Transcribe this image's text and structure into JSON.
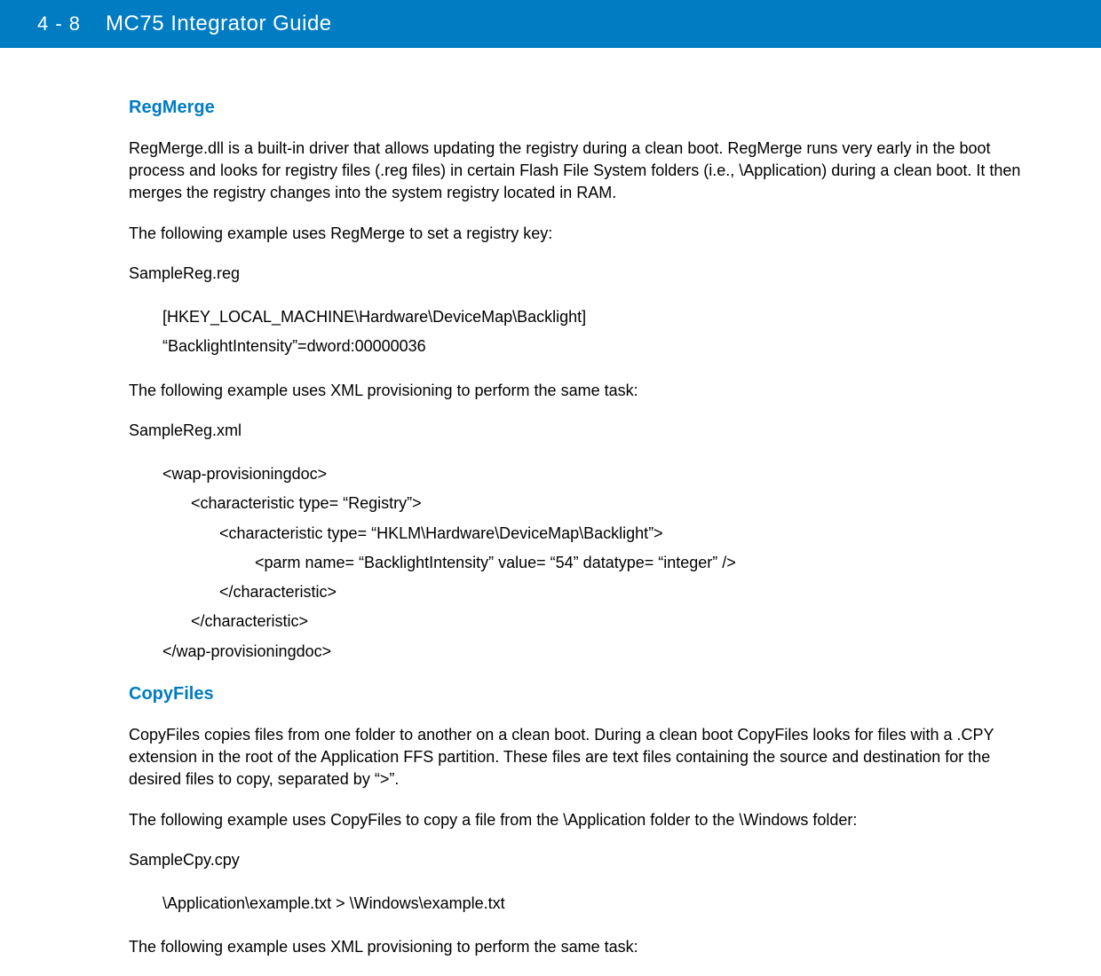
{
  "header": {
    "page_number": "4 - 8",
    "doc_title": "MC75 Integrator Guide"
  },
  "sections": {
    "regmerge": {
      "heading": "RegMerge",
      "intro": "RegMerge.dll is a built-in driver that allows updating the registry during a clean boot. RegMerge runs very early in the boot process and looks for registry files (.reg files) in certain Flash File System folders (i.e., \\Application) during a clean boot. It then merges the registry changes into the system registry located in RAM.",
      "example_lead": "The following example uses RegMerge to set a registry key:",
      "example_filename": "SampleReg.reg",
      "reg_line1": "[HKEY_LOCAL_MACHINE\\Hardware\\DeviceMap\\Backlight]",
      "reg_line2": "“BacklightIntensity”=dword:00000036",
      "xml_lead": "The following example uses XML provisioning to perform the same task:",
      "xml_filename": "SampleReg.xml",
      "xml_l1": "<wap-provisioningdoc>",
      "xml_l2": "<characteristic type= “Registry”>",
      "xml_l3": "<characteristic type= “HKLM\\Hardware\\DeviceMap\\Backlight”>",
      "xml_l4": "<parm name= “BacklightIntensity” value= “54” datatype= “integer” />",
      "xml_l5": "</characteristic>",
      "xml_l6": "</characteristic>",
      "xml_l7": "</wap-provisioningdoc>"
    },
    "copyfiles": {
      "heading": "CopyFiles",
      "intro": "CopyFiles copies files from one folder to another on a clean boot. During a clean boot CopyFiles looks for files with a .CPY extension in the root of the Application FFS partition. These files are text files containing the source and destination for the desired files to copy, separated by “>”.",
      "example_lead": "The following example uses CopyFiles to copy a file from the \\Application folder to the \\Windows folder:",
      "example_filename": "SampleCpy.cpy",
      "cpy_line1": "\\Application\\example.txt > \\Windows\\example.txt",
      "xml_lead": "The following example uses XML provisioning to perform the same task:"
    }
  }
}
